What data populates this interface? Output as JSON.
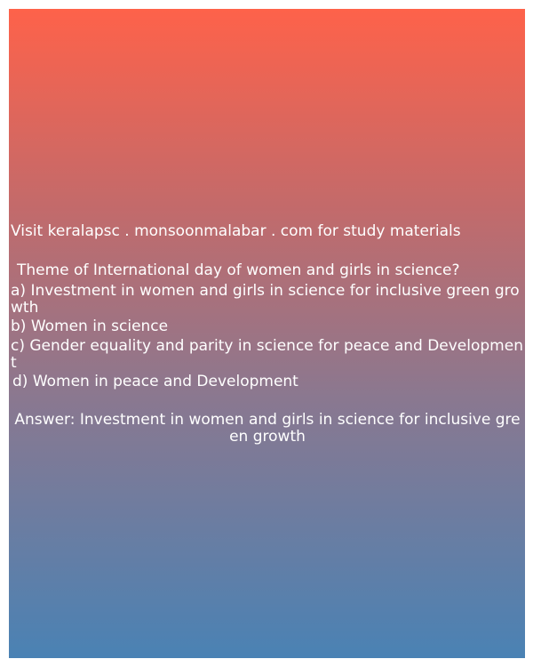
{
  "site_text": "Visit keralapsc . monsoonmalabar . com for study materials",
  "question": "Theme of International day of women and girls in science?",
  "options": [
    "a) Investment in women and girls in science for inclusive green growth",
    "b) Women in science",
    "c) Gender equality and parity in science for peace and Development",
    "d) Women in peace and Development"
  ],
  "answer": "Answer: Investment in women and girls in science for inclusive green growth",
  "colors": {
    "gradient_top": "#fe624a",
    "gradient_bottom": "#4a82b4",
    "text": "#ffffff"
  }
}
